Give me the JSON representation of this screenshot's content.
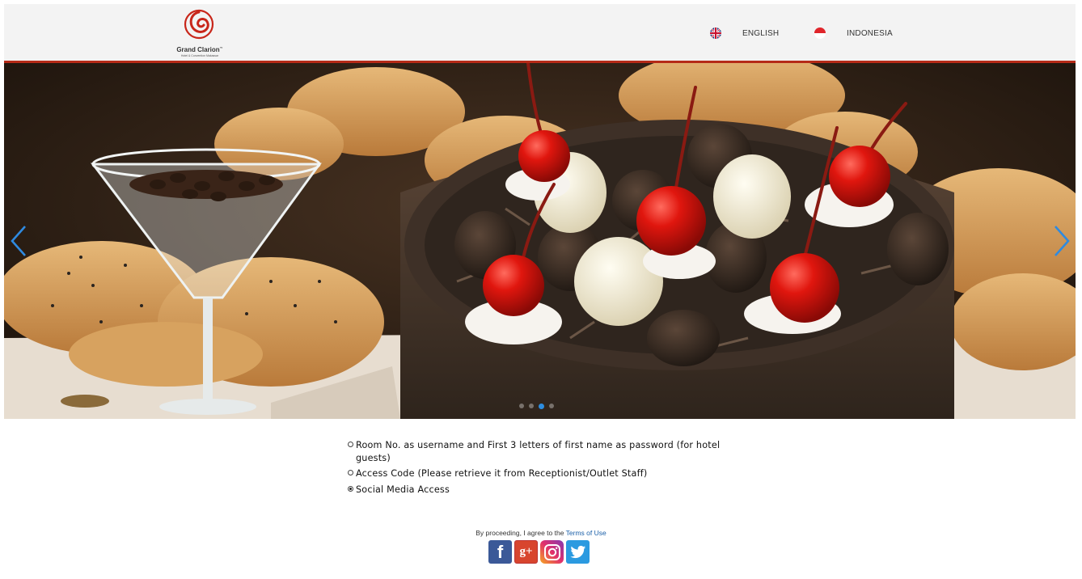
{
  "header": {
    "logo": {
      "name": "Grand Clarion",
      "trademark": "™",
      "subtitle": "Hotel & Convention Makassar"
    },
    "languages": [
      {
        "label": "ENGLISH",
        "icon": "uk-flag-icon"
      },
      {
        "label": "INDONESIA",
        "icon": "indonesia-flag-icon"
      }
    ],
    "accent_color": "#b52a17"
  },
  "carousel": {
    "slide_count": 4,
    "active_index": 2,
    "prev_icon": "chevron-left-icon",
    "next_icon": "chevron-right-icon"
  },
  "login_options": [
    {
      "label": "Room No. as username and First 3 letters of first name as password (for hotel guests)",
      "selected": false
    },
    {
      "label": "Access Code (Please retrieve it from Receptionist/Outlet Staff)",
      "selected": false
    },
    {
      "label": "Social Media Access",
      "selected": true
    }
  ],
  "terms": {
    "prefix": "By proceeding, I agree to the ",
    "link": "Terms of Use"
  },
  "social": [
    {
      "name": "facebook",
      "icon": "facebook-icon",
      "glyph": "f"
    },
    {
      "name": "google-plus",
      "icon": "google-plus-icon",
      "glyph": "g+"
    },
    {
      "name": "instagram",
      "icon": "instagram-icon"
    },
    {
      "name": "twitter",
      "icon": "twitter-icon"
    }
  ]
}
